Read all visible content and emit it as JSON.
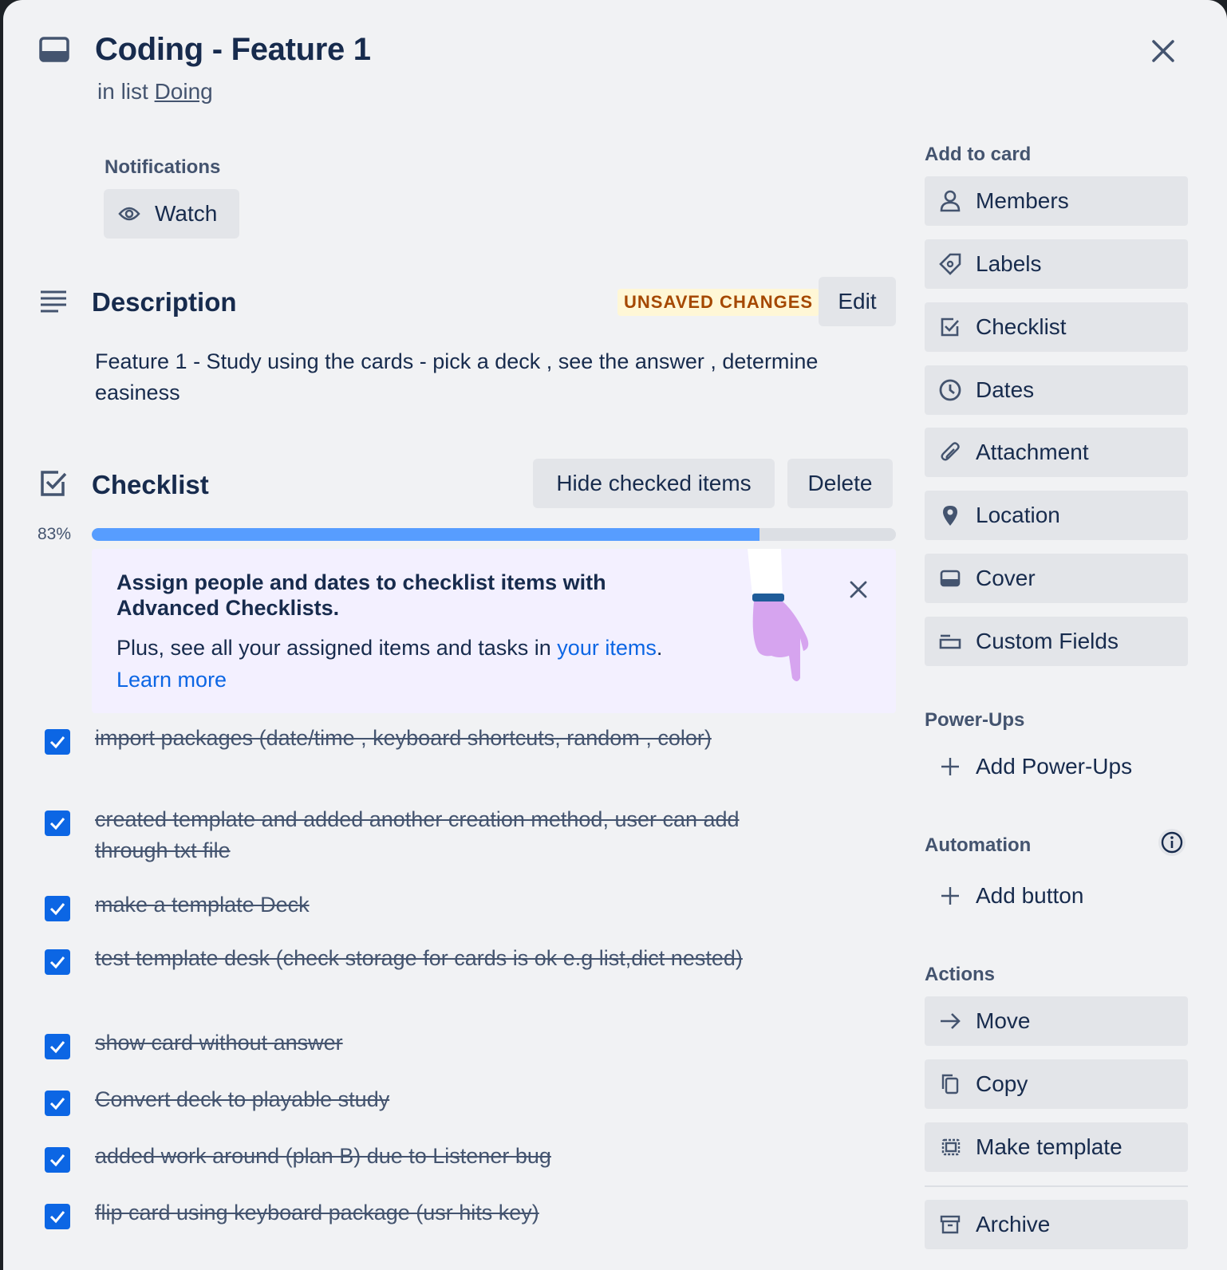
{
  "card": {
    "title": "Coding - Feature 1",
    "in_list_prefix": "in list",
    "list_name": "Doing"
  },
  "notifications": {
    "heading": "Notifications",
    "watch_label": "Watch"
  },
  "description": {
    "heading": "Description",
    "unsaved_badge": "UNSAVED CHANGES",
    "edit_label": "Edit",
    "text": "Feature 1 - Study using the cards - pick a deck , see the answer , determine easiness"
  },
  "checklist": {
    "heading": "Checklist",
    "hide_checked_label": "Hide checked items",
    "delete_label": "Delete",
    "progress_text": "83%",
    "progress_value": 0.83,
    "promo": {
      "title": "Assign people and dates to checklist items with Advanced Checklists.",
      "body_prefix": "Plus, see all your assigned items and tasks in",
      "body_link": "your items",
      "body_suffix": ".",
      "learn_more": "Learn more"
    },
    "items": [
      {
        "text": "import packages (date/time , keyboard shortcuts, random , color)",
        "checked": true
      },
      {
        "text": "created template and added another creation method, user can add through txt file",
        "checked": true
      },
      {
        "text": "make a template Deck",
        "checked": true
      },
      {
        "text": "test template desk (check storage for cards is ok e.g list,dict nested)",
        "checked": true
      },
      {
        "text": "show card without answer",
        "checked": true
      },
      {
        "text": "Convert deck to playable study",
        "checked": true
      },
      {
        "text": "added work around (plan B) due to Listener bug",
        "checked": true
      },
      {
        "text": "flip card using keyboard package (usr hits key)",
        "checked": true
      }
    ]
  },
  "sidebar": {
    "add_to_card": {
      "heading": "Add to card",
      "items": [
        {
          "label": "Members",
          "icon": "person-icon"
        },
        {
          "label": "Labels",
          "icon": "tag-icon"
        },
        {
          "label": "Checklist",
          "icon": "checklist-icon"
        },
        {
          "label": "Dates",
          "icon": "clock-icon"
        },
        {
          "label": "Attachment",
          "icon": "paperclip-icon"
        },
        {
          "label": "Location",
          "icon": "map-pin-icon"
        },
        {
          "label": "Cover",
          "icon": "cover-icon"
        },
        {
          "label": "Custom Fields",
          "icon": "custom-fields-icon"
        }
      ]
    },
    "power_ups": {
      "heading": "Power-Ups",
      "add_label": "Add Power-Ups"
    },
    "automation": {
      "heading": "Automation",
      "add_label": "Add button"
    },
    "actions": {
      "heading": "Actions",
      "items": [
        {
          "label": "Move",
          "icon": "arrow-right-icon"
        },
        {
          "label": "Copy",
          "icon": "copy-icon"
        },
        {
          "label": "Make template",
          "icon": "template-icon"
        },
        {
          "label": "Archive",
          "icon": "archive-icon"
        }
      ]
    }
  },
  "colors": {
    "accent": "#0c66e4",
    "progress": "#579dff",
    "badge_bg": "#fff7d6",
    "badge_text": "#a54800"
  }
}
